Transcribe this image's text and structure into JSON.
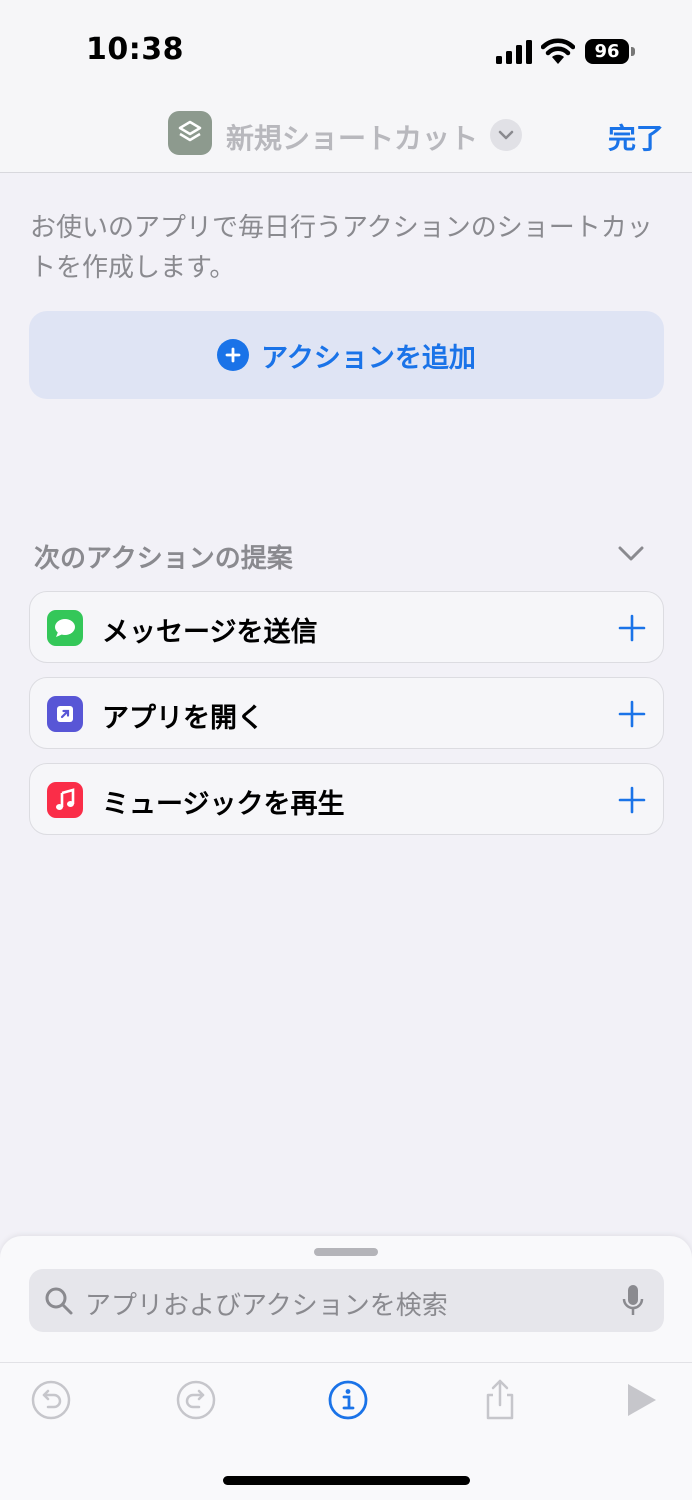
{
  "status": {
    "time": "10:38",
    "battery": "96"
  },
  "nav": {
    "title": "新規ショートカット",
    "done_label": "完了"
  },
  "description": "お使いのアプリで毎日行うアクションのショートカットを作成します。",
  "add_action": {
    "label": "アクションを追加"
  },
  "suggestions": {
    "header": "次のアクションの提案",
    "items": [
      {
        "label": "メッセージを送信",
        "icon": "messages-icon",
        "color": "#34c759"
      },
      {
        "label": "アプリを開く",
        "icon": "open-app-icon",
        "color": "#5856d6"
      },
      {
        "label": "ミュージックを再生",
        "icon": "music-icon",
        "color": "#fa2d48"
      }
    ]
  },
  "search": {
    "placeholder": "アプリおよびアクションを検索"
  },
  "colors": {
    "accent": "#1a73e8",
    "background": "#f2f1f7"
  }
}
